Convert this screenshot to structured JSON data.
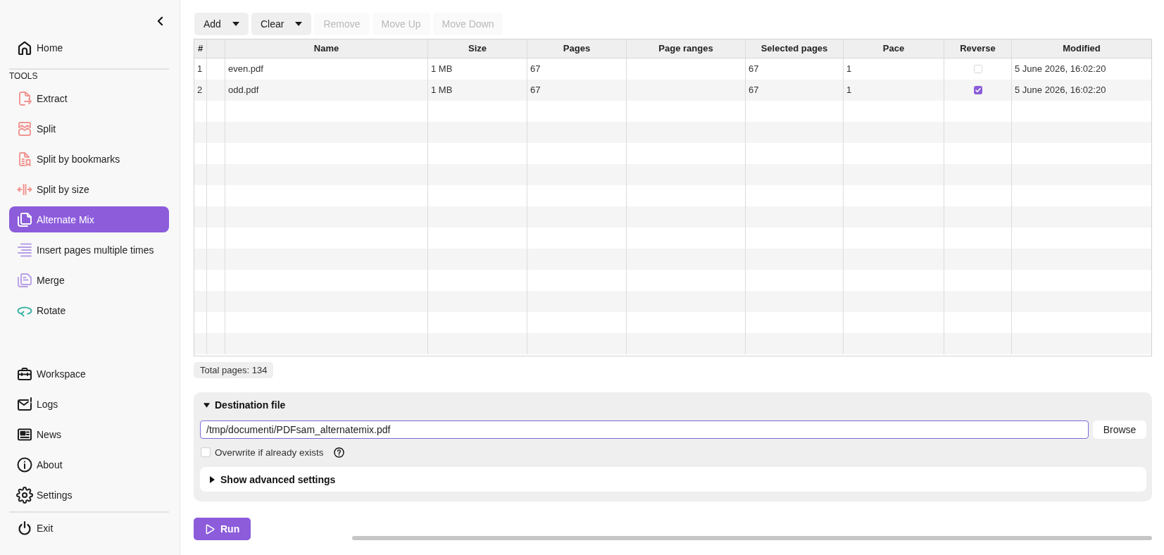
{
  "sidebar": {
    "home": {
      "label": "Home",
      "selected": false
    },
    "tools_heading": "TOOLS",
    "tools": [
      {
        "label": "Extract",
        "selected": false
      },
      {
        "label": "Split",
        "selected": false
      },
      {
        "label": "Split by bookmarks",
        "selected": false
      },
      {
        "label": "Split by size",
        "selected": false
      },
      {
        "label": "Alternate Mix",
        "selected": true
      },
      {
        "label": "Insert pages multiple times",
        "selected": false
      },
      {
        "label": "Merge",
        "selected": false
      },
      {
        "label": "Rotate",
        "selected": false
      }
    ],
    "bottom_items": [
      {
        "label": "Workspace",
        "selected": false
      },
      {
        "label": "Logs",
        "selected": false
      },
      {
        "label": "News",
        "selected": false
      },
      {
        "label": "About",
        "selected": false
      },
      {
        "label": "Settings",
        "selected": false
      }
    ],
    "exit": {
      "label": "Exit",
      "selected": false
    }
  },
  "toolbar": [
    {
      "label": "Add",
      "kind": "menu",
      "disabled": false
    },
    {
      "label": "Clear",
      "kind": "menu",
      "disabled": false
    },
    {
      "label": "Remove",
      "kind": "plain",
      "disabled": true
    },
    {
      "label": "Move Up",
      "kind": "plain",
      "disabled": true
    },
    {
      "label": "Move Down",
      "kind": "plain",
      "disabled": true
    }
  ],
  "table": {
    "columns": [
      {
        "label": "#",
        "kind": "text"
      },
      {
        "kind": "blank"
      },
      {
        "label": "Name",
        "kind": "text"
      },
      {
        "label": "Size",
        "kind": "text"
      },
      {
        "label": "Pages",
        "kind": "text"
      },
      {
        "label": "Page ranges",
        "kind": "text"
      },
      {
        "label": "Selected pages",
        "kind": "text"
      },
      {
        "label": "Pace",
        "kind": "text"
      },
      {
        "label": "Reverse",
        "kind": "check"
      },
      {
        "label": "Modified",
        "kind": "text"
      }
    ],
    "rows": [
      {
        "number": "1",
        "name": "even.pdf",
        "size": "1 MB",
        "pages": "67",
        "selected_pages": "67",
        "pace": "1",
        "reverse": false,
        "modified": "5 June 2026, 16:02:20"
      },
      {
        "number": "2",
        "name": "odd.pdf",
        "size": "1 MB",
        "pages": "67",
        "selected_pages": "67",
        "pace": "1",
        "reverse": true,
        "modified": "5 June 2026, 16:02:20"
      }
    ]
  },
  "total_pages": "Total pages: 134",
  "destination": {
    "title": "Destination file",
    "expanded": true,
    "path": "/tmp/documenti/PDFsam_alternatemix.pdf",
    "focused": true,
    "browse_button": "Browse",
    "overwrite": {
      "label": "Overwrite if already exists",
      "checked": false
    },
    "advanced": {
      "label": "Show advanced settings",
      "expanded": false
    }
  },
  "run_button": "Run"
}
